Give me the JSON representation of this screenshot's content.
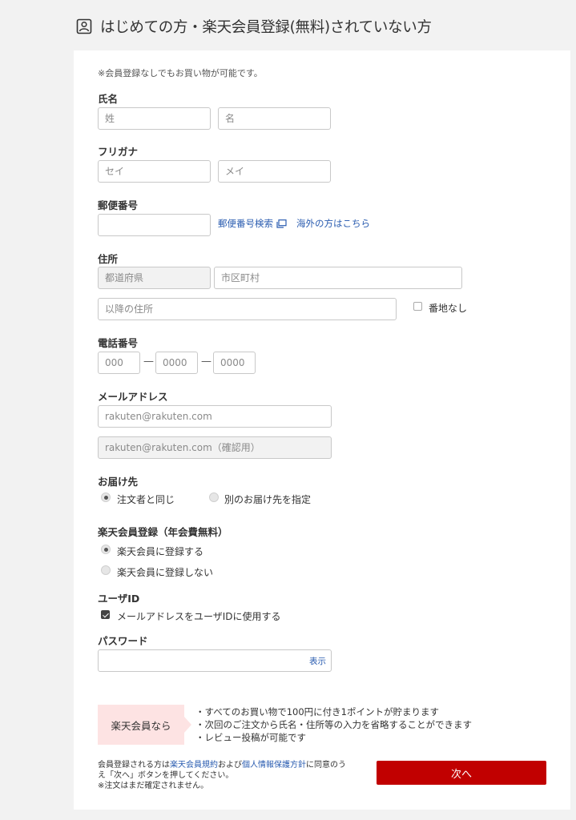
{
  "header": {
    "title": "はじめての方・楽天会員登録(無料)されていない方",
    "icon": "id-card-icon"
  },
  "form": {
    "note": "※会員登録なしでもお買い物が可能です。",
    "name": {
      "label": "氏名",
      "last_placeholder": "姓",
      "first_placeholder": "名"
    },
    "kana": {
      "label": "フリガナ",
      "last_placeholder": "セイ",
      "first_placeholder": "メイ"
    },
    "postal": {
      "label": "郵便番号",
      "value": "",
      "search_link": "郵便番号検索",
      "overseas_link": "海外の方はこちら"
    },
    "address": {
      "label": "住所",
      "prefecture_placeholder": "都道府県",
      "city_placeholder": "市区町村",
      "rest_placeholder": "以降の住所",
      "no_number_label": "番地なし",
      "no_number_checked": false
    },
    "phone": {
      "label": "電話番号",
      "p1": "000",
      "p2": "0000",
      "p3": "0000",
      "sep": "—"
    },
    "email": {
      "label": "メールアドレス",
      "placeholder": "rakuten@rakuten.com",
      "confirm_placeholder": "rakuten@rakuten.com（確認用）"
    },
    "delivery": {
      "label": "お届け先",
      "options": [
        {
          "label": "注文者と同じ",
          "selected": true
        },
        {
          "label": "別のお届け先を指定",
          "selected": false
        }
      ]
    },
    "membership": {
      "label": "楽天会員登録（年会費無料）",
      "options": [
        {
          "label": "楽天会員に登録する",
          "selected": true
        },
        {
          "label": "楽天会員に登録しない",
          "selected": false
        }
      ]
    },
    "userid": {
      "label": "ユーザID",
      "checkbox_label": "メールアドレスをユーザIDに使用する",
      "checked": true
    },
    "password": {
      "label": "パスワード",
      "value": "",
      "show_link": "表示"
    }
  },
  "benefits": {
    "box_label": "楽天会員なら",
    "items": [
      "・すべてのお買い物で100円に付き1ポイントが貯まります",
      "・次回のご注文から氏名・住所等の入力を省略することができます",
      "・レビュー投稿が可能です"
    ]
  },
  "consent": {
    "text_pre": "会員登録される方は",
    "terms_link": "楽天会員規約",
    "text_mid": "および",
    "privacy_link": "個人情報保護方針",
    "text_post": "に同意のうえ「次へ」ボタンを押してください。",
    "note": "※注文はまだ確定されません。"
  },
  "next_button": "次へ",
  "colors": {
    "accent": "#c10000",
    "link": "#2a5cb0",
    "benefit_bg": "#fde3e3"
  }
}
